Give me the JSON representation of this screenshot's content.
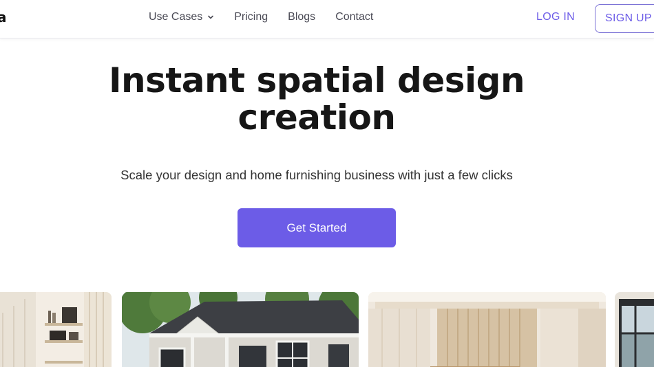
{
  "header": {
    "logo_text": "a",
    "nav": [
      {
        "label": "Use Cases",
        "has_dropdown": true
      },
      {
        "label": "Pricing"
      },
      {
        "label": "Blogs"
      },
      {
        "label": "Contact"
      }
    ],
    "login_label": "LOG IN",
    "signup_label": "SIGN UP"
  },
  "hero": {
    "title_line1": "Instant spatial design",
    "title_line2": "creation",
    "subtitle": "Scale your design and home furnishing business with just a few clicks",
    "cta_label": "Get Started"
  },
  "gallery": [
    {
      "name": "interior-shelving-image"
    },
    {
      "name": "house-exterior-image"
    },
    {
      "name": "living-room-image"
    },
    {
      "name": "window-room-image"
    }
  ],
  "colors": {
    "accent": "#6c5ce7",
    "text_dark": "#161616",
    "nav_text": "#4a4a55"
  },
  "icons": [
    "chevron-down-icon"
  ]
}
